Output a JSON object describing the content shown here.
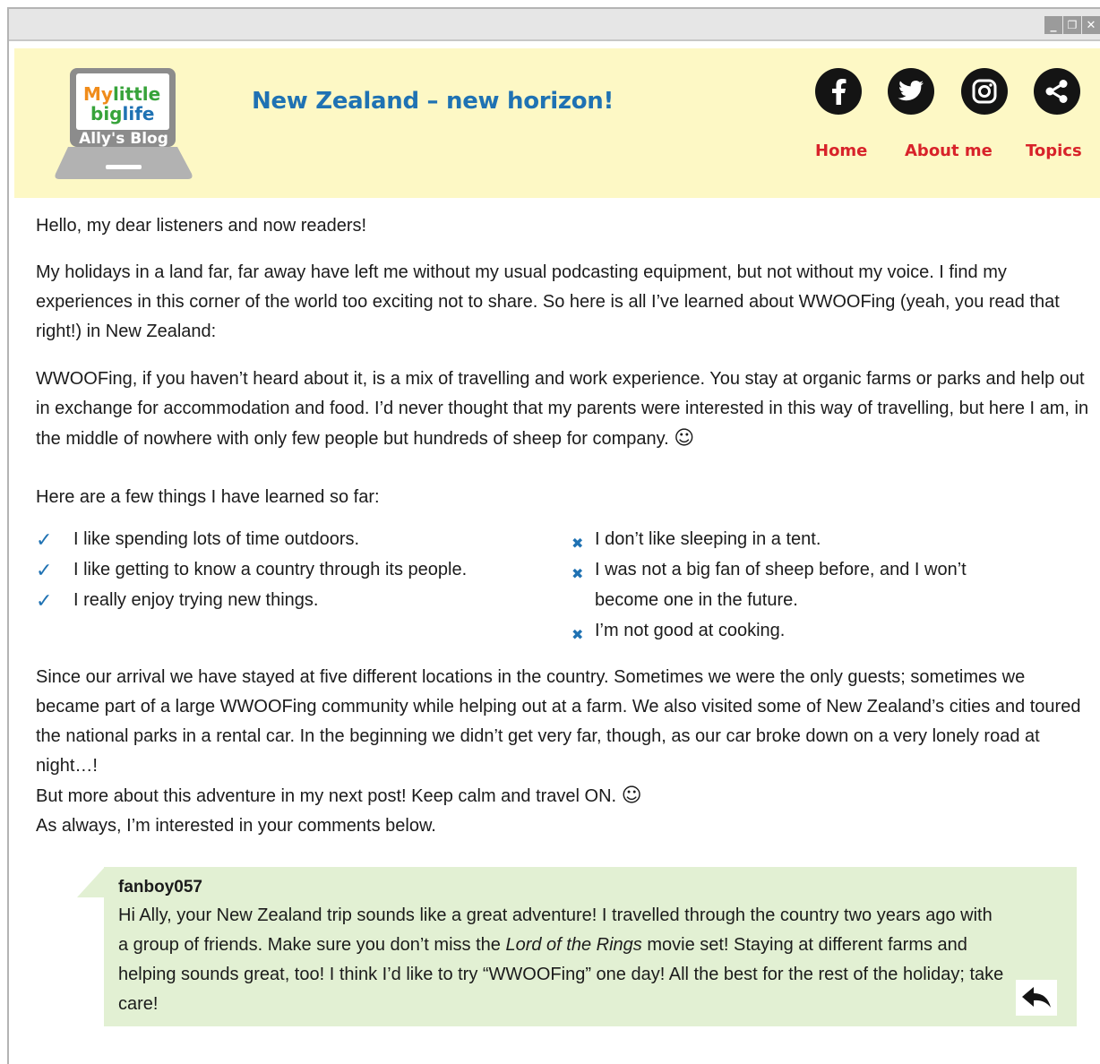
{
  "window": {
    "controls": {
      "minimize": "_",
      "restore": "❐",
      "close": "✕"
    }
  },
  "header": {
    "logo": {
      "line1_a": "My",
      "line1_b": "little",
      "line2_a": "big",
      "line2_b": "life",
      "caption": "Ally's Blog"
    },
    "title": "New Zealand – new horizon!",
    "social": [
      "facebook-icon",
      "twitter-icon",
      "instagram-icon",
      "share-icon"
    ],
    "nav": {
      "home": "Home",
      "about": "About me",
      "topics": "Topics"
    }
  },
  "post": {
    "greeting": "Hello, my dear listeners and now readers!",
    "para1": "My holidays in a land far, far away have left me without my usual podcasting equipment, but not without my voice. I find my experiences in this corner of the world too exciting not to share. So here is all I’ve learned about WWOOFing (yeah, you read that right!) in New Zealand:",
    "para2": "WWOOFing, if you haven’t heard about it, is a mix of travelling and work experience. You stay at organic farms or parks and help out in exchange for accommodation and food. I’d never thought that my parents were interested in this way of travelling, but here I am, in the middle of nowhere with only few people but hundreds of sheep for company.",
    "learned_intro": "Here are a few things I have learned so far:",
    "likes": [
      "I like spending lots of time outdoors.",
      "I like getting to know a country through its people.",
      "I really enjoy trying new things."
    ],
    "dislikes": [
      "I don’t like sleeping in a tent.",
      "I was not a big fan of sheep before, and I won’t",
      "become one in the future.",
      "I’m not good at cooking."
    ],
    "para3": "Since our arrival we have stayed at five different locations in the country. Sometimes we were the only guests; sometimes we became part of a large WWOOFing community while helping out at a farm. We also visited some of New Zealand’s cities and toured the national parks in a rental car. In the beginning we didn’t get very far, though, as our car broke down on a very lonely road at night…!",
    "para4": "But more about this adventure in my next post! Keep calm and travel ON.",
    "para5": "As always, I’m interested in your comments below.",
    "smiley": "☺"
  },
  "comment": {
    "user": "fanboy057",
    "text_a": "Hi Ally, your New Zealand trip sounds like a great adventure! I travelled through the country two years ago with a group of friends. Make sure you don’t miss the ",
    "text_italic": "Lord of the Rings",
    "text_b": " movie set! Staying at different farms and helping sounds great, too! I think I’d like to try “WWOOFing” one day! All the best for the rest of the holiday; take care!",
    "reply_icon": "reply-icon"
  },
  "colors": {
    "accent": "#1f72b3",
    "nav": "#d8232a",
    "header_bg": "#fdf8c5",
    "comment_bg": "#e2f0d3"
  }
}
